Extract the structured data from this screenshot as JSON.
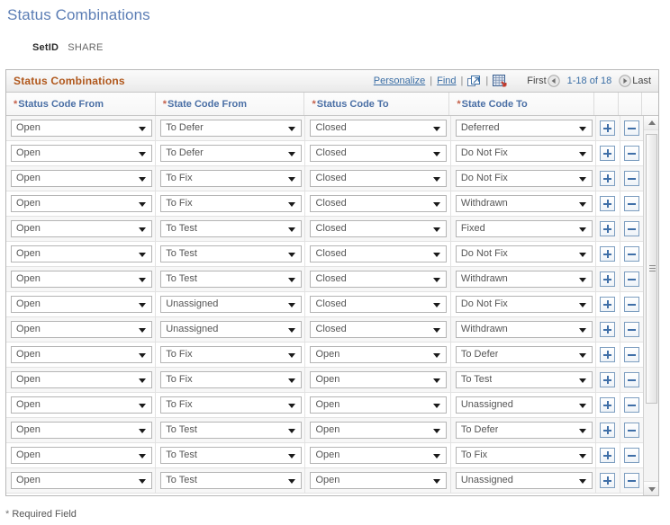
{
  "page": {
    "title": "Status Combinations",
    "required_note_star": "*",
    "required_note": "Required Field"
  },
  "setid": {
    "label": "SetID",
    "value": "SHARE"
  },
  "grid": {
    "title": "Status Combinations",
    "toolbar": {
      "personalize": "Personalize",
      "find": "Find",
      "separator": "|",
      "zoom_icon": "new-window-icon",
      "download_icon": "download-to-spreadsheet-icon"
    },
    "nav": {
      "first": "First",
      "prev_icon": "previous-page-icon",
      "range": "1-18 of 18",
      "next_icon": "next-page-icon",
      "last": "Last"
    },
    "columns": [
      {
        "required": "*",
        "label": "Status Code From"
      },
      {
        "required": "*",
        "label": "State Code From"
      },
      {
        "required": "*",
        "label": "Status Code To"
      },
      {
        "required": "*",
        "label": "State Code To"
      }
    ],
    "row_buttons": {
      "add_label": "+",
      "delete_label": "-",
      "add_name": "add-row-button",
      "delete_name": "delete-row-button"
    },
    "rows": [
      {
        "status_from": "Open",
        "state_from": "To Defer",
        "status_to": "Closed",
        "state_to": "Deferred"
      },
      {
        "status_from": "Open",
        "state_from": "To Defer",
        "status_to": "Closed",
        "state_to": "Do Not Fix"
      },
      {
        "status_from": "Open",
        "state_from": "To Fix",
        "status_to": "Closed",
        "state_to": "Do Not Fix"
      },
      {
        "status_from": "Open",
        "state_from": "To Fix",
        "status_to": "Closed",
        "state_to": "Withdrawn"
      },
      {
        "status_from": "Open",
        "state_from": "To Test",
        "status_to": "Closed",
        "state_to": "Fixed"
      },
      {
        "status_from": "Open",
        "state_from": "To Test",
        "status_to": "Closed",
        "state_to": "Do Not Fix"
      },
      {
        "status_from": "Open",
        "state_from": "To Test",
        "status_to": "Closed",
        "state_to": "Withdrawn"
      },
      {
        "status_from": "Open",
        "state_from": "Unassigned",
        "status_to": "Closed",
        "state_to": "Do Not Fix"
      },
      {
        "status_from": "Open",
        "state_from": "Unassigned",
        "status_to": "Closed",
        "state_to": "Withdrawn"
      },
      {
        "status_from": "Open",
        "state_from": "To Fix",
        "status_to": "Open",
        "state_to": "To Defer"
      },
      {
        "status_from": "Open",
        "state_from": "To Fix",
        "status_to": "Open",
        "state_to": "To Test"
      },
      {
        "status_from": "Open",
        "state_from": "To Fix",
        "status_to": "Open",
        "state_to": "Unassigned"
      },
      {
        "status_from": "Open",
        "state_from": "To Test",
        "status_to": "Open",
        "state_to": "To Defer"
      },
      {
        "status_from": "Open",
        "state_from": "To Test",
        "status_to": "Open",
        "state_to": "To Fix"
      },
      {
        "status_from": "Open",
        "state_from": "To Test",
        "status_to": "Open",
        "state_to": "Unassigned"
      }
    ]
  },
  "colors": {
    "page_title": "#5c7eb5",
    "grid_title": "#b0571b",
    "column_header": "#4a6fa5",
    "link": "#3a6ea5",
    "required_marker": "#c4604a",
    "button_accent": "#3f6fa8"
  }
}
